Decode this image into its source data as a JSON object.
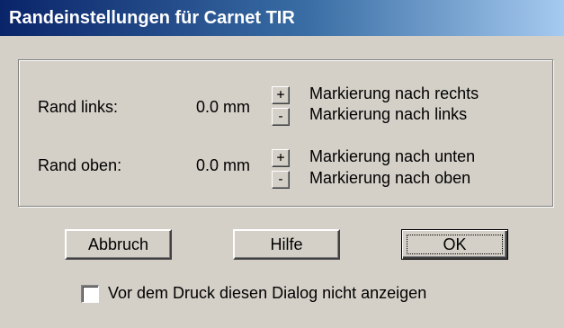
{
  "dialog": {
    "title": "Randeinstellungen für Carnet TIR"
  },
  "margins": {
    "left": {
      "label": "Rand links:",
      "value": "0.0 mm",
      "plus": "+",
      "minus": "-",
      "plus_desc": "Markierung nach rechts",
      "minus_desc": "Markierung nach links"
    },
    "top": {
      "label": "Rand oben:",
      "value": "0.0 mm",
      "plus": "+",
      "minus": "-",
      "plus_desc": "Markierung nach unten",
      "minus_desc": "Markierung nach oben"
    }
  },
  "buttons": {
    "cancel": "Abbruch",
    "help": "Hilfe",
    "ok": "OK"
  },
  "checkbox": {
    "label": "Vor dem Druck diesen Dialog nicht anzeigen",
    "checked": false
  }
}
